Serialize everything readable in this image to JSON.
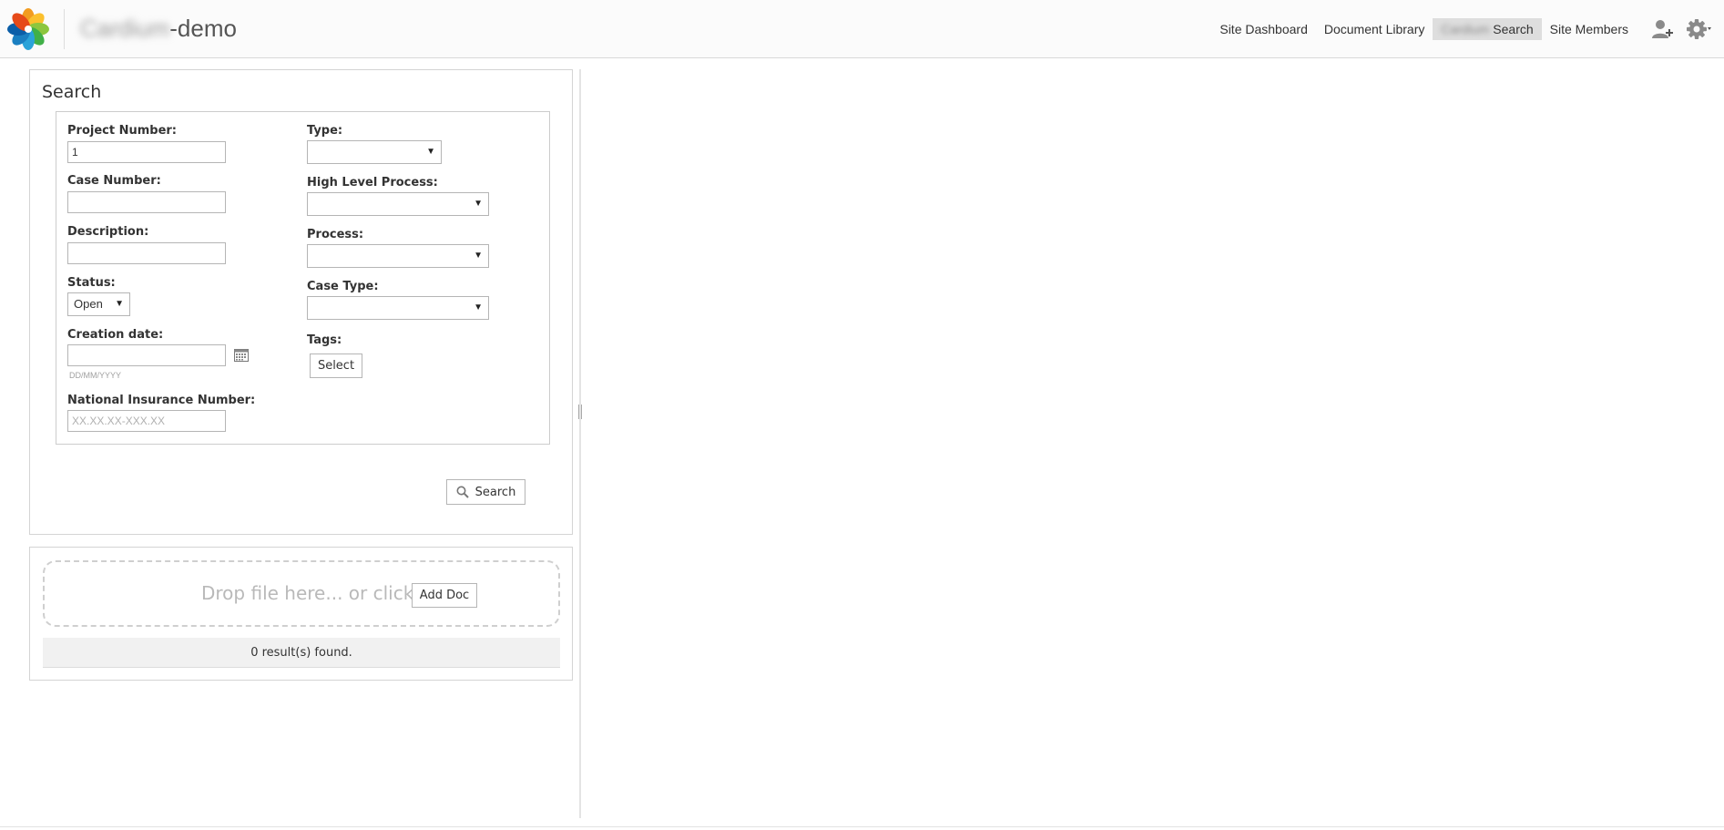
{
  "header": {
    "site_title_blurred": "Cardium",
    "site_title_suffix": "-demo",
    "nav": [
      {
        "label": "Site Dashboard"
      },
      {
        "label": "Document Library"
      },
      {
        "label_blurred": "Cardium",
        "label": "Search",
        "active": true
      },
      {
        "label": "Site Members"
      }
    ],
    "user_icon": "add-user-icon",
    "settings_icon": "gear-icon"
  },
  "search": {
    "title": "Search",
    "project_number": {
      "label": "Project Number:",
      "value": "1"
    },
    "case_number": {
      "label": "Case Number:",
      "value": ""
    },
    "description": {
      "label": "Description:",
      "value": ""
    },
    "status": {
      "label": "Status:",
      "value": "Open"
    },
    "creation_date": {
      "label": "Creation date:",
      "value": "",
      "hint": "DD/MM/YYYY"
    },
    "nin": {
      "label": "National Insurance Number:",
      "placeholder": "XX.XX.XX-XXX.XX"
    },
    "type": {
      "label": "Type:",
      "value": ""
    },
    "high_level_process": {
      "label": "High Level Process:",
      "value": ""
    },
    "process": {
      "label": "Process:",
      "value": ""
    },
    "case_type": {
      "label": "Case Type:",
      "value": ""
    },
    "tags": {
      "label": "Tags:",
      "button": "Select"
    },
    "search_button": "Search"
  },
  "results": {
    "drop_text": "Drop file here... or click",
    "add_doc_button": "Add Doc",
    "count_text": "0 result(s) found."
  },
  "colors": {
    "logo": [
      "#f29c1f",
      "#8cc63e",
      "#40b048",
      "#1a7fc1",
      "#2aa3d9",
      "#0b5ea8"
    ]
  }
}
